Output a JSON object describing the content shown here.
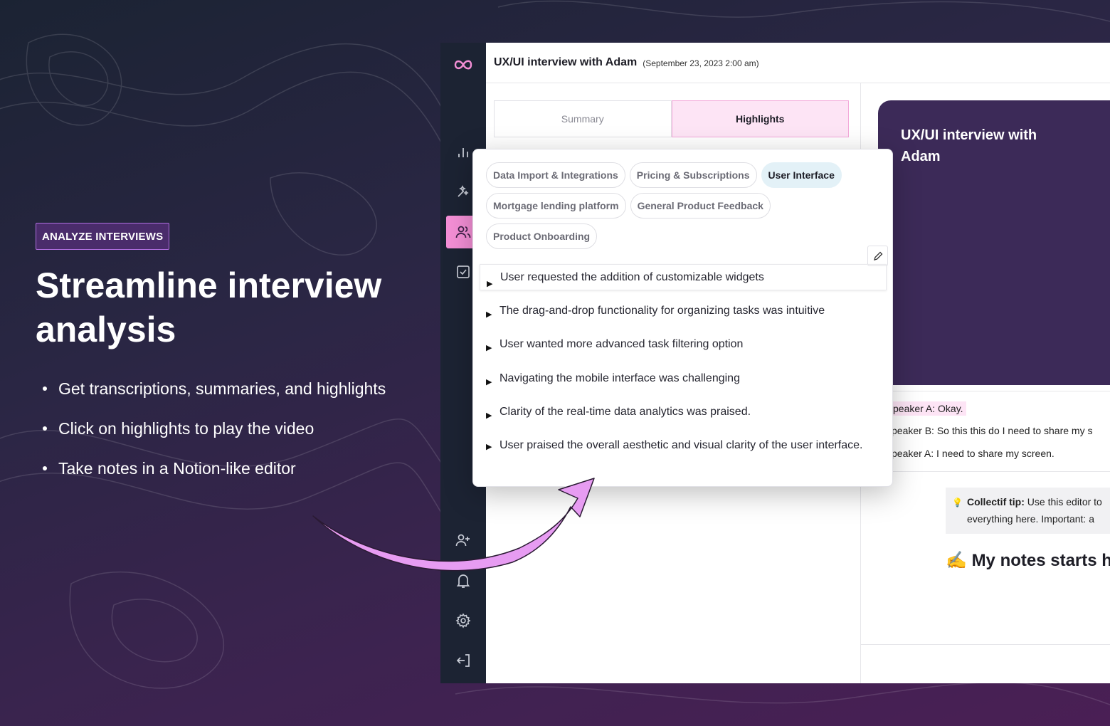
{
  "marketing": {
    "badge": "ANALYZE INTERVIEWS",
    "headline_line1": "Streamline interview",
    "headline_line2": "analysis",
    "bullets": [
      "Get transcriptions, summaries, and highlights",
      "Click on highlights to play the video",
      "Take notes in a Notion-like editor"
    ]
  },
  "header": {
    "title": "UX/UI interview with Adam",
    "date": "(September 23, 2023 2:00 am)"
  },
  "tabs": {
    "summary": "Summary",
    "highlights": "Highlights"
  },
  "sidebar": {
    "icons": [
      "logo-icon",
      "chart-icon",
      "magic-wand-icon",
      "users-icon",
      "checkbox-icon",
      "add-user-icon",
      "bell-icon",
      "gear-icon",
      "logout-icon"
    ],
    "active": "users-icon"
  },
  "video": {
    "title": "UX/UI interview with Adam"
  },
  "transcript": [
    "peaker A: Okay.",
    "peaker B: So this this do I need to share my s",
    "peaker A: I need to share my screen."
  ],
  "tip": {
    "label": "Collectif tip:",
    "text1": " Use this editor to",
    "text2": "everything here. Important: a"
  },
  "notes": {
    "emoji": "✍️",
    "title": "My notes starts he"
  },
  "highlights_popup": {
    "chips": [
      "Data Import & Integrations",
      "Pricing & Subscriptions",
      "User Interface",
      "Mortgage lending platform",
      "General Product Feedback",
      "Product Onboarding"
    ],
    "active_chip": "User Interface",
    "items": [
      "User requested the addition of customizable widgets",
      "The drag-and-drop functionality for organizing tasks was intuitive",
      "User wanted more advanced task filtering option",
      "Navigating the mobile interface was challenging",
      "Clarity of the real-time data analytics was praised.",
      "User praised the overall aesthetic and visual clarity of the user interface."
    ]
  },
  "colors": {
    "accent_pink": "#f48fd6",
    "rail_bg": "#1c2333",
    "video_bg": "#3c2a58",
    "arrow": "#e79cf2"
  }
}
